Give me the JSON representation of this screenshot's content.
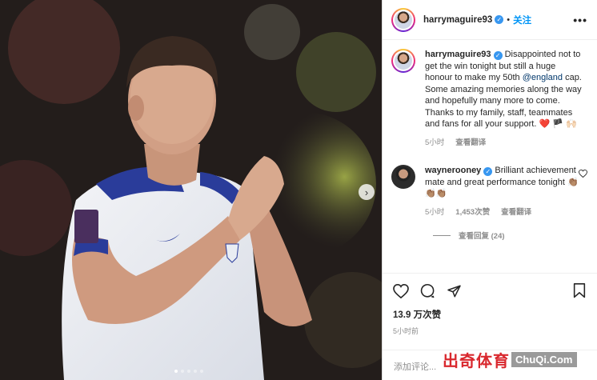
{
  "post": {
    "username": "harrymaguire93",
    "separator": "•",
    "follow_label": "关注",
    "more_label": "•••",
    "caption_mention": "@england",
    "caption_before": "Disappointed not to get the win tonight but still a huge honour to make my 50th ",
    "caption_after": " cap. Some amazing memories along the way and hopefully many more to come. Thanks to my family, staff, teammates and fans for all your support. ",
    "caption_emojis": "❤️ 🏴 🙌🏻",
    "caption_time": "5小时",
    "see_translation": "查看翻译",
    "likes": "13.9 万次赞",
    "posted_time": "5小时前",
    "add_comment_placeholder": "添加评论..."
  },
  "comment": {
    "username": "waynerooney",
    "text": "Brilliant achievement mate and great performance tonight ",
    "emojis": "👏🏽👏🏽👏🏽",
    "time": "5小时",
    "likes": "1,453次赞",
    "see_translation": "查看翻译",
    "view_replies": "查看回复 (24)"
  },
  "photo": {
    "next_arrow": "›",
    "slides": 5,
    "active_slide": 1
  },
  "watermark": {
    "cn": "出奇体育",
    "en": "ChuQi.Com"
  },
  "icons": {
    "verified": "verified-badge-icon",
    "heart": "heart-icon",
    "comment": "comment-icon",
    "share": "share-icon",
    "save": "bookmark-icon"
  },
  "colors": {
    "follow_blue": "#0095f6",
    "verified_blue": "#3897f0",
    "mention": "#00376b",
    "watermark_red": "#d9282e"
  }
}
